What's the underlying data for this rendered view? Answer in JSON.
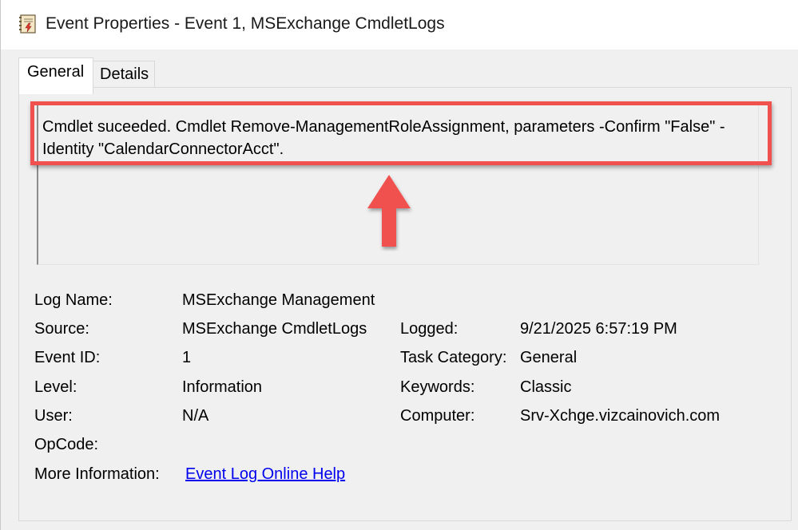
{
  "window": {
    "title": "Event Properties - Event 1, MSExchange CmdletLogs",
    "icon": "event-viewer-icon"
  },
  "tabs": [
    {
      "label": "General",
      "selected": true
    },
    {
      "label": "Details",
      "selected": false
    }
  ],
  "description": {
    "line1": "Cmdlet suceeded. Cmdlet Remove-ManagementRoleAssignment, parameters -Confirm \"False\" -",
    "line2": "Identity \"CalendarConnectorAcct\"."
  },
  "annotation": {
    "highlight_color": "#f0514f",
    "arrow_icon": "up-arrow-icon"
  },
  "fields": {
    "log_name": {
      "label": "Log Name:",
      "value": "MSExchange Management"
    },
    "source": {
      "label": "Source:",
      "value": "MSExchange CmdletLogs"
    },
    "logged": {
      "label": "Logged:",
      "value": "9/21/2025 6:57:19 PM"
    },
    "event_id": {
      "label": "Event ID:",
      "value": "1"
    },
    "task_category": {
      "label": "Task Category:",
      "value": "General"
    },
    "level": {
      "label": "Level:",
      "value": "Information"
    },
    "keywords": {
      "label": "Keywords:",
      "value": "Classic"
    },
    "user": {
      "label": "User:",
      "value": "N/A"
    },
    "computer": {
      "label": "Computer:",
      "value": "Srv-Xchge.vizcainovich.com"
    },
    "opcode": {
      "label": "OpCode:",
      "value": ""
    },
    "more_info": {
      "label": "More Information:",
      "link": "Event Log Online Help"
    }
  }
}
